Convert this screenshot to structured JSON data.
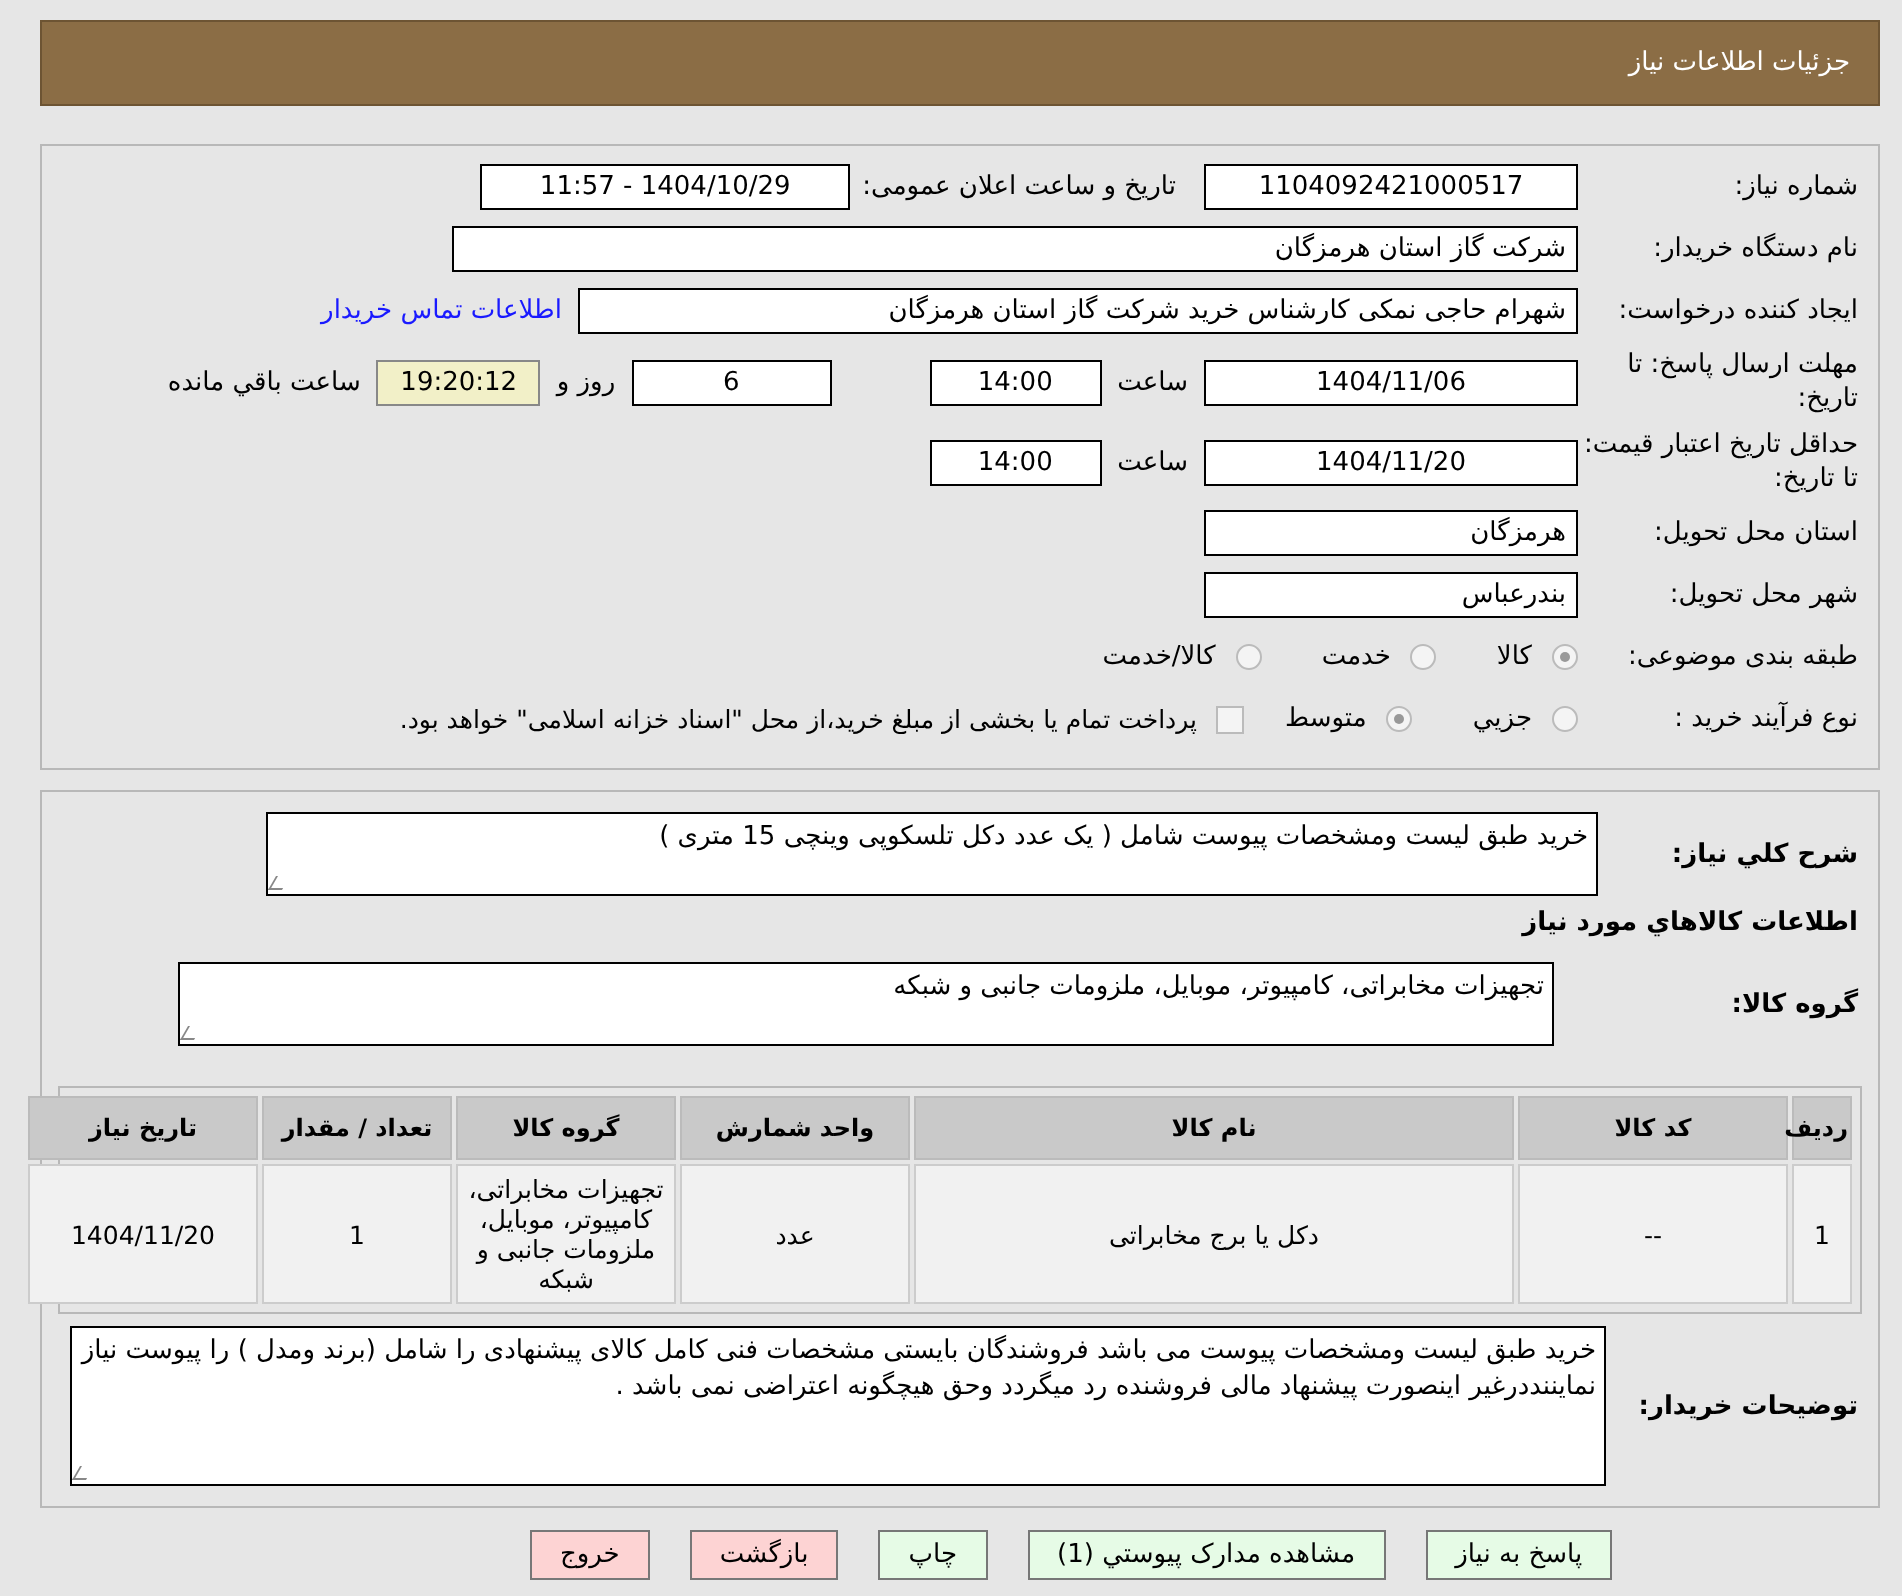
{
  "header": {
    "title": "جزئیات اطلاعات نیاز"
  },
  "need_number": {
    "label": "شماره نیاز:",
    "value": "1104092421000517"
  },
  "announce": {
    "label": "تاریخ و ساعت اعلان عمومی:",
    "value": "1404/10/29 - 11:57"
  },
  "buyer": {
    "label": "نام دستگاه خریدار:",
    "value": "شرکت گاز استان هرمزگان"
  },
  "requester": {
    "label": "ایجاد کننده درخواست:",
    "value": "شهرام حاجی نمکی کارشناس خرید شرکت گاز استان هرمزگان",
    "link": "اطلاعات تماس خریدار"
  },
  "deadline": {
    "label": "مهلت ارسال پاسخ: تا تاریخ:",
    "date": "1404/11/06",
    "time_label": "ساعت",
    "time": "14:00",
    "days": "6",
    "days_label": "روز و",
    "remaining": "19:20:12",
    "remaining_label": "ساعت باقي مانده"
  },
  "validity": {
    "label": "حداقل تاریخ اعتبار قیمت: تا تاریخ:",
    "date": "1404/11/20",
    "time_label": "ساعت",
    "time": "14:00"
  },
  "province": {
    "label": "استان محل تحویل:",
    "value": "هرمزگان"
  },
  "city": {
    "label": "شهر محل تحویل:",
    "value": "بندرعباس"
  },
  "category": {
    "label": "طبقه بندی موضوعی:",
    "options": [
      {
        "label": "کالا",
        "selected": true
      },
      {
        "label": "خدمت",
        "selected": false
      },
      {
        "label": "کالا/خدمت",
        "selected": false
      }
    ]
  },
  "process": {
    "label": "نوع فرآیند خرید :",
    "options": [
      {
        "label": "جزیي",
        "selected": false
      },
      {
        "label": "متوسط",
        "selected": true
      }
    ],
    "payment_checked": false,
    "payment_note": "پرداخت تمام یا بخشی از مبلغ خرید،از محل \"اسناد خزانه اسلامی\" خواهد بود."
  },
  "description": {
    "label": "شرح کلي نیاز:",
    "value": "خرید طبق لیست ومشخصات پیوست شامل ( یک عدد دکل تلسکوپی وینچی 15 متری )"
  },
  "goods_title": "اطلاعات کالاهاي مورد نیاز",
  "goods_group": {
    "label": "گروه کالا:",
    "value": "تجهیزات مخابراتی، کامپیوتر، موبایل، ملزومات جانبی و شبکه"
  },
  "table": {
    "columns": [
      "ردیف",
      "کد کالا",
      "نام کالا",
      "واحد شمارش",
      "گروه کالا",
      "تعداد / مقدار",
      "تاریخ نیاز"
    ],
    "rows": [
      [
        "1",
        "--",
        "دکل یا برج مخابراتی",
        "عدد",
        "تجهیزات مخابراتی، کامپیوتر، موبایل، ملزومات جانبی و شبکه",
        "1",
        "1404/11/20"
      ]
    ]
  },
  "buyer_notes": {
    "label": "توضیحات خریدار:",
    "value": "خرید طبق لیست ومشخصات پیوست می باشد فروشندگان بایستی مشخصات فنی کامل کالای پیشنهادی را شامل (برند ومدل ) را پیوست نیاز نمایننددرغیر اینصورت پیشنهاد مالی فروشنده رد میگردد وحق هیچگونه اعتراضی نمی باشد ."
  },
  "buttons": [
    {
      "label": "پاسخ به نیاز",
      "kind": "action"
    },
    {
      "label": "مشاهده مدارک پیوستي (1)",
      "kind": "action"
    },
    {
      "label": "چاپ",
      "kind": "action"
    },
    {
      "label": "بازگشت",
      "kind": "exit"
    },
    {
      "label": "خروج",
      "kind": "exit"
    }
  ]
}
